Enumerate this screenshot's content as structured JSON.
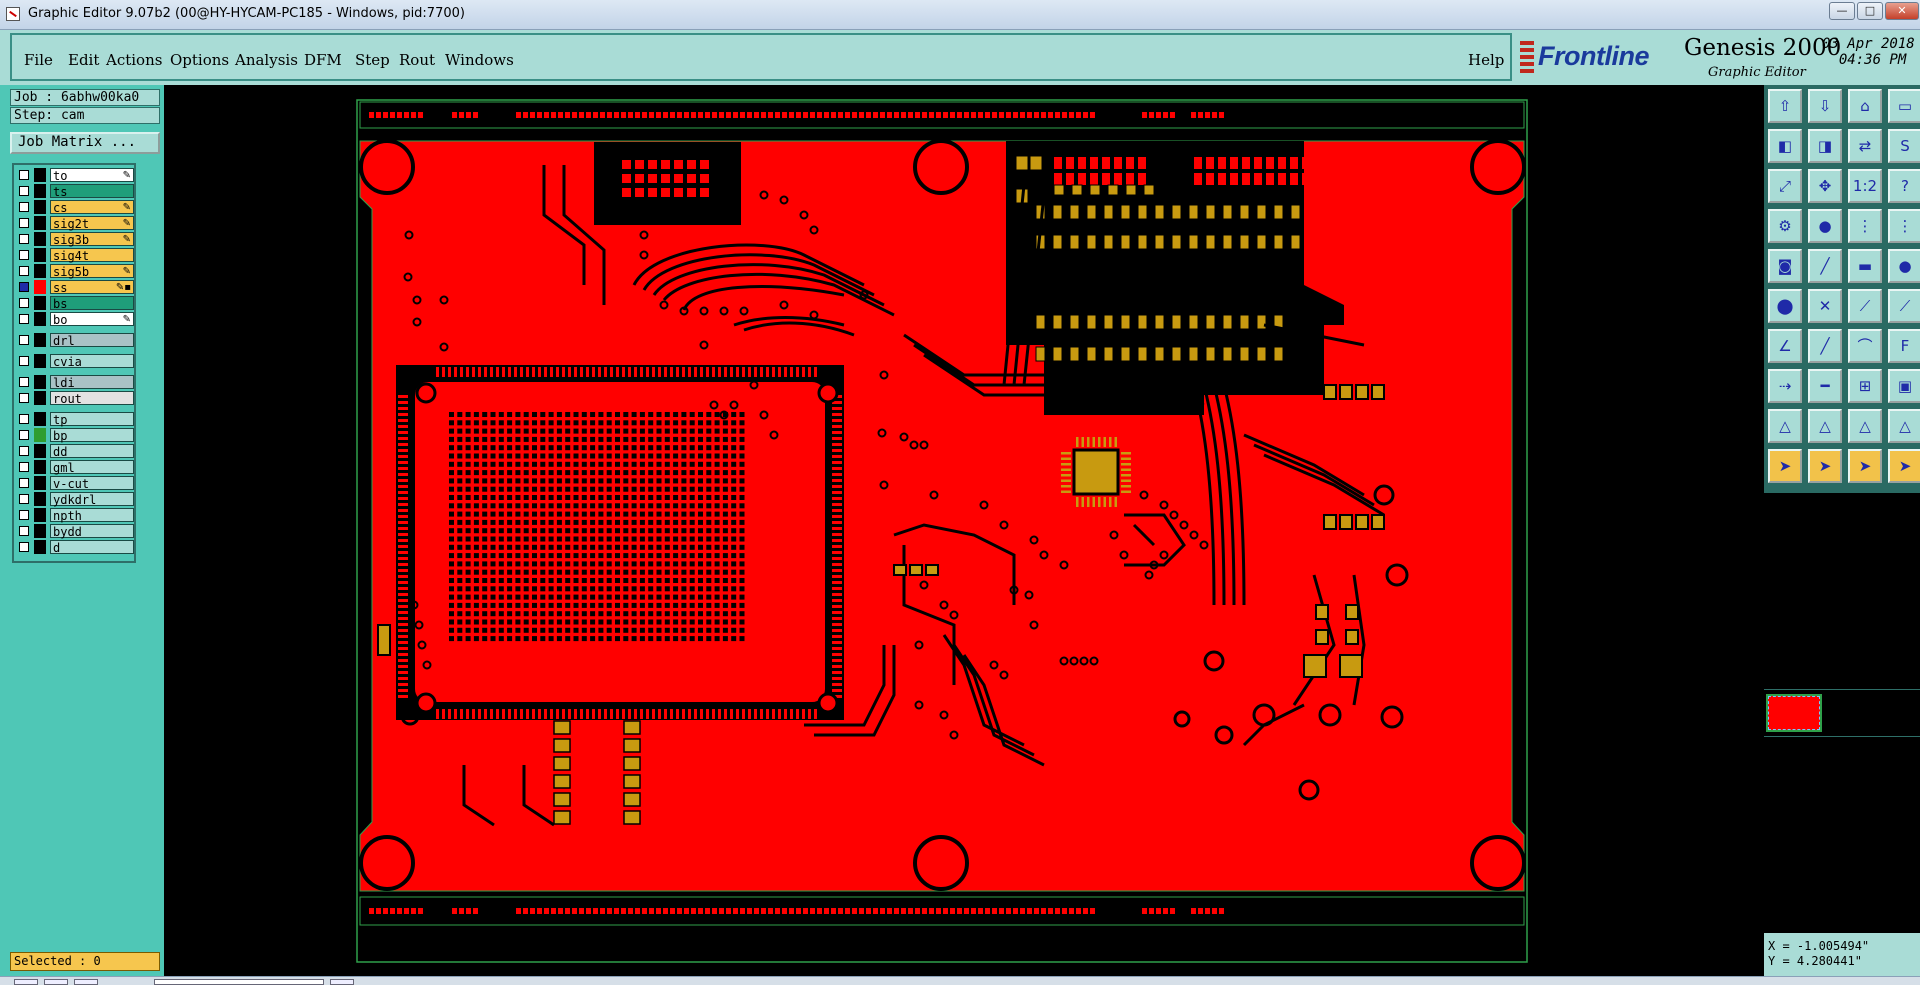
{
  "window": {
    "title": "Graphic Editor 9.07b2 (00@HY-HYCAM-PC185 - Windows, pid:7700)",
    "controls": {
      "minimize": "—",
      "maximize": "□",
      "close": "✕"
    }
  },
  "menu": {
    "items": [
      {
        "label": "File",
        "key": "F"
      },
      {
        "label": "Edit",
        "key": "E"
      },
      {
        "label": "Actions",
        "key": "A"
      },
      {
        "label": "Options",
        "key": "O"
      },
      {
        "label": "Analysis",
        "key": "A"
      },
      {
        "label": "DFM",
        "key": "D"
      },
      {
        "label": "Step",
        "key": "S"
      },
      {
        "label": "Rout",
        "key": "R"
      },
      {
        "label": "Windows",
        "key": "W"
      }
    ],
    "help": "Help"
  },
  "brand": {
    "logo": "Frontline",
    "product": "Genesis 2000",
    "subtitle": "Graphic Editor",
    "date": "03 Apr 2018",
    "time": "04:36 PM"
  },
  "job": {
    "label": "Job : 6abhw00ka0",
    "step": "Step: cam",
    "matrix_button": "Job Matrix ..."
  },
  "layers": [
    {
      "name": "to",
      "color": "#ffffff",
      "swatch": "#000000",
      "mark": "✎",
      "active": false
    },
    {
      "name": "ts",
      "color": "#1f9e7a",
      "swatch": "#000000",
      "mark": "",
      "active": false
    },
    {
      "name": "cs",
      "color": "#f6c64e",
      "swatch": "#000000",
      "mark": "✎",
      "active": false
    },
    {
      "name": "sig2t",
      "color": "#f6c64e",
      "swatch": "#000000",
      "mark": "✎",
      "active": false
    },
    {
      "name": "sig3b",
      "color": "#f6c64e",
      "swatch": "#000000",
      "mark": "✎",
      "active": false
    },
    {
      "name": "sig4t",
      "color": "#f6c64e",
      "swatch": "#000000",
      "mark": "",
      "active": false
    },
    {
      "name": "sig5b",
      "color": "#f6c64e",
      "swatch": "#000000",
      "mark": "✎",
      "active": false
    },
    {
      "name": "ss",
      "color": "#f6c64e",
      "swatch": "#ff0000",
      "mark": "✎▪",
      "active": true
    },
    {
      "name": "bs",
      "color": "#1f9e7a",
      "swatch": "#000000",
      "mark": "",
      "active": false
    },
    {
      "name": "bo",
      "color": "#ffffff",
      "swatch": "#000000",
      "mark": "✎",
      "active": false
    },
    {
      "name": "drl",
      "color": "#a9c2c6",
      "swatch": "#000000",
      "mark": "",
      "active": false,
      "gap": true
    },
    {
      "name": "cvia",
      "color": "#a9dcd6",
      "swatch": "#000000",
      "mark": "",
      "active": false,
      "gap": true
    },
    {
      "name": "ldi",
      "color": "#a9c2c6",
      "swatch": "#000000",
      "mark": "",
      "active": false,
      "gap": true
    },
    {
      "name": "rout",
      "color": "#e2e2e2",
      "swatch": "#000000",
      "mark": "",
      "active": false
    },
    {
      "name": "tp",
      "color": "#a9dcd6",
      "swatch": "#000000",
      "mark": "",
      "active": false,
      "gap": true
    },
    {
      "name": "bp",
      "color": "#a9dcd6",
      "swatch": "#2f9e2f",
      "mark": "",
      "active": false
    },
    {
      "name": "dd",
      "color": "#a9dcd6",
      "swatch": "#000000",
      "mark": "",
      "active": false
    },
    {
      "name": "gml",
      "color": "#a9dcd6",
      "swatch": "#000000",
      "mark": "",
      "active": false
    },
    {
      "name": "v-cut",
      "color": "#a9dcd6",
      "swatch": "#000000",
      "mark": "",
      "active": false
    },
    {
      "name": "ydkdrl",
      "color": "#a9dcd6",
      "swatch": "#000000",
      "mark": "",
      "active": false
    },
    {
      "name": "npth",
      "color": "#a9dcd6",
      "swatch": "#000000",
      "mark": "",
      "active": false
    },
    {
      "name": "bydd",
      "color": "#a9dcd6",
      "swatch": "#000000",
      "mark": "",
      "active": false
    },
    {
      "name": "d",
      "color": "#a9dcd6",
      "swatch": "#000000",
      "mark": "",
      "active": false
    }
  ],
  "status": {
    "selected": "Selected : 0",
    "x": "X = -1.005494\"",
    "y": "Y = 4.280441\""
  },
  "tools": [
    {
      "name": "home-icon",
      "glyph": "⇧"
    },
    {
      "name": "save-icon",
      "glyph": "⇩"
    },
    {
      "name": "house-icon",
      "glyph": "⌂"
    },
    {
      "name": "window-icon",
      "glyph": "▭"
    },
    {
      "name": "pan-left-icon",
      "glyph": "◧"
    },
    {
      "name": "pan-right-icon",
      "glyph": "◨"
    },
    {
      "name": "flip-icon",
      "glyph": "⇄"
    },
    {
      "name": "snap-icon",
      "glyph": "S"
    },
    {
      "name": "zoom-fit-icon",
      "glyph": "⤢"
    },
    {
      "name": "zoom-home-icon",
      "glyph": "✥"
    },
    {
      "name": "scale-icon",
      "glyph": "1:2"
    },
    {
      "name": "help-icon",
      "glyph": "?"
    },
    {
      "name": "measure-icon",
      "glyph": "⚙"
    },
    {
      "name": "probe-icon",
      "glyph": "●"
    },
    {
      "name": "netlist-icon",
      "glyph": "⋮"
    },
    {
      "name": "layers-icon",
      "glyph": "⋮"
    },
    {
      "name": "pad-icon",
      "glyph": "◙"
    },
    {
      "name": "line-icon",
      "glyph": "╱"
    },
    {
      "name": "rect-icon",
      "glyph": "▬"
    },
    {
      "name": "circle-icon",
      "glyph": "●"
    },
    {
      "name": "node-icon",
      "glyph": "⬤"
    },
    {
      "name": "cross-icon",
      "glyph": "✕"
    },
    {
      "name": "connect-icon",
      "glyph": "⟋"
    },
    {
      "name": "link-icon",
      "glyph": "⟋"
    },
    {
      "name": "draw-line-icon",
      "glyph": "∠"
    },
    {
      "name": "draw-diag-icon",
      "glyph": "╱"
    },
    {
      "name": "arc-icon",
      "glyph": "⌒"
    },
    {
      "name": "text-icon",
      "glyph": "F"
    },
    {
      "name": "move-icon",
      "glyph": "⇢"
    },
    {
      "name": "cut-icon",
      "glyph": "━"
    },
    {
      "name": "copy-icon",
      "glyph": "⊞"
    },
    {
      "name": "group-icon",
      "glyph": "▣"
    },
    {
      "name": "tri-icon",
      "glyph": "△"
    },
    {
      "name": "tri2-icon",
      "glyph": "△"
    },
    {
      "name": "tri3-icon",
      "glyph": "△"
    },
    {
      "name": "tri4-icon",
      "glyph": "△"
    },
    {
      "name": "pointer-icon",
      "glyph": "➤"
    },
    {
      "name": "pointer-select-icon",
      "glyph": "➤"
    },
    {
      "name": "pointer-area-icon",
      "glyph": "➤"
    },
    {
      "name": "pointer-multi-icon",
      "glyph": "➤"
    }
  ],
  "colors": {
    "copper": "#ff0000",
    "pad": "#c89a10",
    "panel": "#a9dcd6",
    "outline": "#2fa04a"
  }
}
